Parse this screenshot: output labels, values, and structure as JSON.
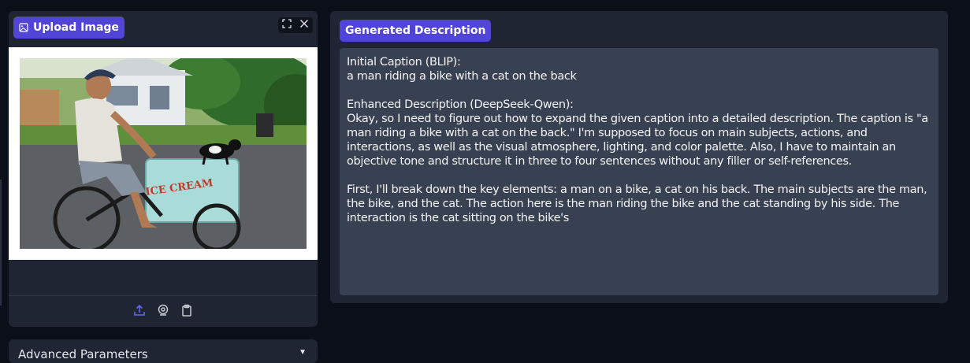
{
  "upload": {
    "label": "Upload Image",
    "tools": [
      "fullscreen-icon",
      "close-icon"
    ],
    "sources": [
      "upload-icon",
      "webcam-icon",
      "clipboard-icon"
    ],
    "image_sign_text": "ICE CREAM"
  },
  "advanced": {
    "label": "Advanced Parameters"
  },
  "output": {
    "label": "Generated Description",
    "text": "Initial Caption (BLIP):\na man riding a bike with a cat on the back\n\nEnhanced Description (DeepSeek-Qwen):\nOkay, so I need to figure out how to expand the given caption into a detailed description. The caption is \"a man riding a bike with a cat on the back.\" I'm supposed to focus on main subjects, actions, and interactions, as well as the visual atmosphere, lighting, and color palette. Also, I have to maintain an objective tone and structure it in three to four sentences without any filler or self-references.\n\nFirst, I'll break down the key elements: a man on a bike, a cat on his back. The main subjects are the man, the bike, and the cat. The action here is the man riding the bike and the cat standing by his side. The interaction is the cat sitting on the bike's"
  },
  "colors": {
    "background": "#0b0f19",
    "panel": "#1f2533",
    "accent": "#5145d8",
    "textbox": "#374151"
  }
}
